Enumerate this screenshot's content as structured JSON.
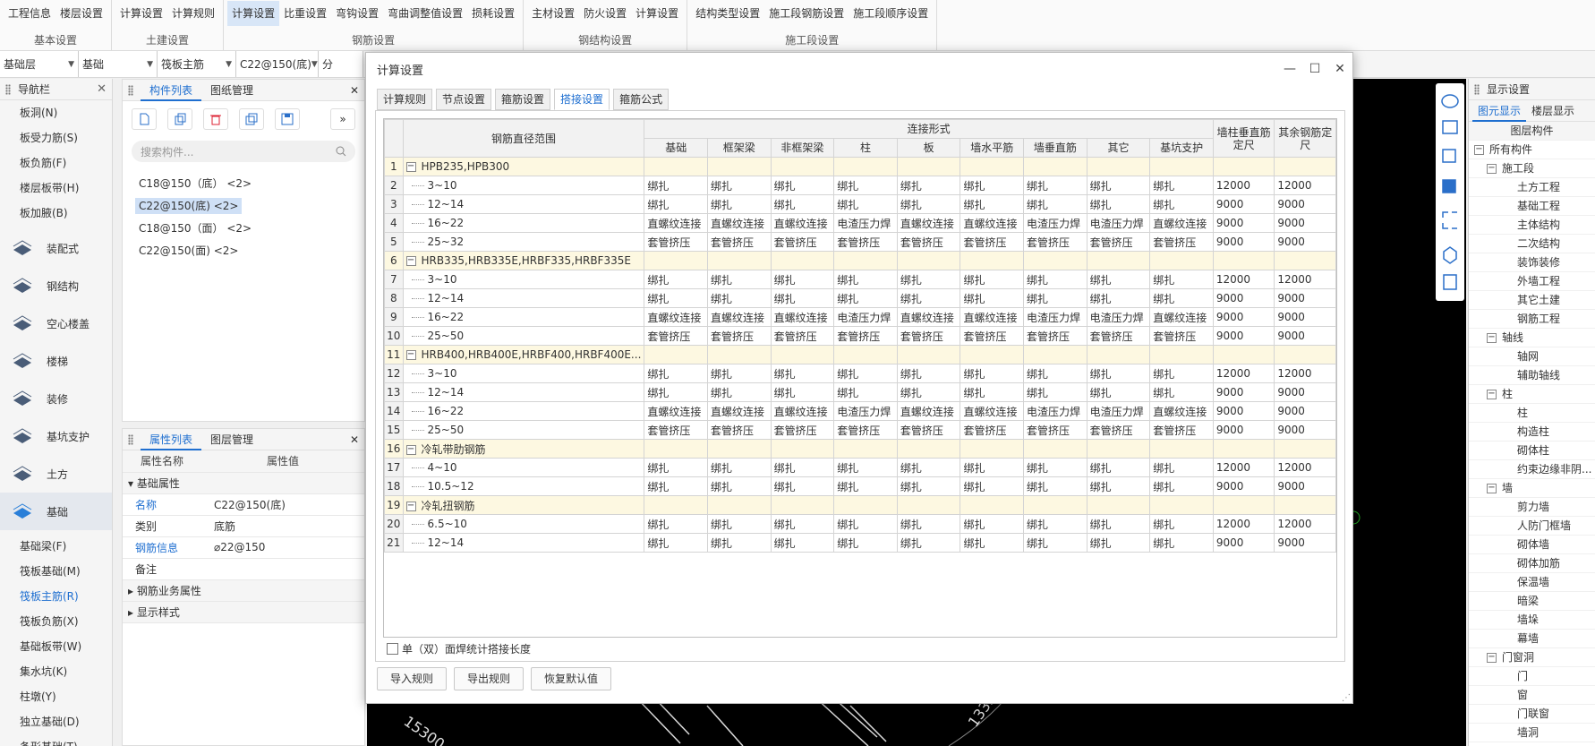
{
  "ribbon": {
    "groups": [
      {
        "title": "基本设置",
        "buttons": [
          "工程信息",
          "楼层设置"
        ]
      },
      {
        "title": "土建设置",
        "buttons": [
          "计算设置",
          "计算规则"
        ]
      },
      {
        "title": "钢筋设置",
        "buttons": [
          "计算设置",
          "比重设置",
          "弯钩设置",
          "弯曲调整值设置",
          "损耗设置"
        ]
      },
      {
        "title": "钢结构设置",
        "buttons": [
          "主材设置",
          "防火设置",
          "计算设置"
        ]
      },
      {
        "title": "施工段设置",
        "buttons": [
          "结构类型设置",
          "施工段钢筋设置",
          "施工段顺序设置"
        ]
      }
    ]
  },
  "selectors": [
    "基础层",
    "基础",
    "筏板主筋",
    "C22@150(底)",
    "分"
  ],
  "nav": {
    "title": "导航栏",
    "items_top": [
      "板洞(N)",
      "板受力筋(S)",
      "板负筋(F)",
      "楼层板带(H)",
      "板加腋(B)"
    ],
    "categories": [
      "装配式",
      "钢结构",
      "空心楼盖",
      "楼梯",
      "装修",
      "基坑支护",
      "土方",
      "基础"
    ],
    "items_bottom": [
      "基础梁(F)",
      "筏板基础(M)",
      "筏板主筋(R)",
      "筏板负筋(X)",
      "基础板带(W)",
      "集水坑(K)",
      "柱墩(Y)",
      "独立基础(D)",
      "条形基础(T)"
    ]
  },
  "complist": {
    "tabs": [
      "构件列表",
      "图纸管理"
    ],
    "search_placeholder": "搜索构件...",
    "items": [
      "C18@150（底） <2>",
      "C22@150(底) <2>",
      "C18@150（面） <2>",
      "C22@150(面) <2>"
    ]
  },
  "props": {
    "tabs": [
      "属性列表",
      "图层管理"
    ],
    "col_name": "属性名称",
    "col_value": "属性值",
    "group1": "基础属性",
    "rows": [
      {
        "name": "名称",
        "value": "C22@150(底)"
      },
      {
        "name": "类别",
        "value": "底筋"
      },
      {
        "name": "钢筋信息",
        "value": "⌀22@150"
      },
      {
        "name": "备注",
        "value": ""
      }
    ],
    "group2": "钢筋业务属性",
    "group3": "显示样式"
  },
  "canvas_labels": [
    "15300",
    "1335"
  ],
  "display": {
    "title": "显示设置",
    "tabs": [
      "图元显示",
      "楼层显示"
    ],
    "header": "图层构件",
    "tree": [
      {
        "level": 0,
        "toggle": true,
        "label": "所有构件"
      },
      {
        "level": 1,
        "toggle": true,
        "label": "施工段"
      },
      {
        "level": 2,
        "toggle": false,
        "label": "土方工程"
      },
      {
        "level": 2,
        "toggle": false,
        "label": "基础工程"
      },
      {
        "level": 2,
        "toggle": false,
        "label": "主体结构"
      },
      {
        "level": 2,
        "toggle": false,
        "label": "二次结构"
      },
      {
        "level": 2,
        "toggle": false,
        "label": "装饰装修"
      },
      {
        "level": 2,
        "toggle": false,
        "label": "外墙工程"
      },
      {
        "level": 2,
        "toggle": false,
        "label": "其它土建"
      },
      {
        "level": 2,
        "toggle": false,
        "label": "钢筋工程"
      },
      {
        "level": 1,
        "toggle": true,
        "label": "轴线"
      },
      {
        "level": 2,
        "toggle": false,
        "label": "轴网"
      },
      {
        "level": 2,
        "toggle": false,
        "label": "辅助轴线"
      },
      {
        "level": 1,
        "toggle": true,
        "label": "柱"
      },
      {
        "level": 2,
        "toggle": false,
        "label": "柱"
      },
      {
        "level": 2,
        "toggle": false,
        "label": "构造柱"
      },
      {
        "level": 2,
        "toggle": false,
        "label": "砌体柱"
      },
      {
        "level": 2,
        "toggle": false,
        "label": "约束边缘非阴..."
      },
      {
        "level": 1,
        "toggle": true,
        "label": "墙"
      },
      {
        "level": 2,
        "toggle": false,
        "label": "剪力墙"
      },
      {
        "level": 2,
        "toggle": false,
        "label": "人防门框墙"
      },
      {
        "level": 2,
        "toggle": false,
        "label": "砌体墙"
      },
      {
        "level": 2,
        "toggle": false,
        "label": "砌体加筋"
      },
      {
        "level": 2,
        "toggle": false,
        "label": "保温墙"
      },
      {
        "level": 2,
        "toggle": false,
        "label": "暗梁"
      },
      {
        "level": 2,
        "toggle": false,
        "label": "墙垛"
      },
      {
        "level": 2,
        "toggle": false,
        "label": "幕墙"
      },
      {
        "level": 1,
        "toggle": true,
        "label": "门窗洞"
      },
      {
        "level": 2,
        "toggle": false,
        "label": "门"
      },
      {
        "level": 2,
        "toggle": false,
        "label": "窗"
      },
      {
        "level": 2,
        "toggle": false,
        "label": "门联窗"
      },
      {
        "level": 2,
        "toggle": false,
        "label": "墙洞"
      }
    ]
  },
  "dialog": {
    "title": "计算设置",
    "tabs": [
      "计算规则",
      "节点设置",
      "箍筋设置",
      "搭接设置",
      "箍筋公式"
    ],
    "active_tab": 3,
    "header": {
      "diameter": "钢筋直径范围",
      "connection": "连接形式",
      "cols": [
        "基础",
        "框架梁",
        "非框架梁",
        "柱",
        "板",
        "墙水平筋",
        "墙垂直筋",
        "其它",
        "基坑支护"
      ],
      "col_wall": "墙柱垂直筋定尺",
      "col_other": "其余钢筋定尺"
    },
    "rows": [
      {
        "n": "1",
        "group": true,
        "label": "HPB235,HPB300"
      },
      {
        "n": "2",
        "label": "3~10",
        "c": [
          "绑扎",
          "绑扎",
          "绑扎",
          "绑扎",
          "绑扎",
          "绑扎",
          "绑扎",
          "绑扎",
          "绑扎"
        ],
        "w": "12000",
        "o": "12000"
      },
      {
        "n": "3",
        "label": "12~14",
        "c": [
          "绑扎",
          "绑扎",
          "绑扎",
          "绑扎",
          "绑扎",
          "绑扎",
          "绑扎",
          "绑扎",
          "绑扎"
        ],
        "w": "9000",
        "o": "9000"
      },
      {
        "n": "4",
        "label": "16~22",
        "c": [
          "直螺纹连接",
          "直螺纹连接",
          "直螺纹连接",
          "电渣压力焊",
          "直螺纹连接",
          "直螺纹连接",
          "电渣压力焊",
          "电渣压力焊",
          "直螺纹连接"
        ],
        "w": "9000",
        "o": "9000"
      },
      {
        "n": "5",
        "label": "25~32",
        "c": [
          "套管挤压",
          "套管挤压",
          "套管挤压",
          "套管挤压",
          "套管挤压",
          "套管挤压",
          "套管挤压",
          "套管挤压",
          "套管挤压"
        ],
        "w": "9000",
        "o": "9000"
      },
      {
        "n": "6",
        "group": true,
        "label": "HRB335,HRB335E,HRBF335,HRBF335E"
      },
      {
        "n": "7",
        "label": "3~10",
        "c": [
          "绑扎",
          "绑扎",
          "绑扎",
          "绑扎",
          "绑扎",
          "绑扎",
          "绑扎",
          "绑扎",
          "绑扎"
        ],
        "w": "12000",
        "o": "12000"
      },
      {
        "n": "8",
        "label": "12~14",
        "c": [
          "绑扎",
          "绑扎",
          "绑扎",
          "绑扎",
          "绑扎",
          "绑扎",
          "绑扎",
          "绑扎",
          "绑扎"
        ],
        "w": "9000",
        "o": "9000"
      },
      {
        "n": "9",
        "label": "16~22",
        "c": [
          "直螺纹连接",
          "直螺纹连接",
          "直螺纹连接",
          "电渣压力焊",
          "直螺纹连接",
          "直螺纹连接",
          "电渣压力焊",
          "电渣压力焊",
          "直螺纹连接"
        ],
        "w": "9000",
        "o": "9000"
      },
      {
        "n": "10",
        "label": "25~50",
        "c": [
          "套管挤压",
          "套管挤压",
          "套管挤压",
          "套管挤压",
          "套管挤压",
          "套管挤压",
          "套管挤压",
          "套管挤压",
          "套管挤压"
        ],
        "w": "9000",
        "o": "9000"
      },
      {
        "n": "11",
        "group": true,
        "label": "HRB400,HRB400E,HRBF400,HRBF400E..."
      },
      {
        "n": "12",
        "label": "3~10",
        "c": [
          "绑扎",
          "绑扎",
          "绑扎",
          "绑扎",
          "绑扎",
          "绑扎",
          "绑扎",
          "绑扎",
          "绑扎"
        ],
        "w": "12000",
        "o": "12000"
      },
      {
        "n": "13",
        "label": "12~14",
        "c": [
          "绑扎",
          "绑扎",
          "绑扎",
          "绑扎",
          "绑扎",
          "绑扎",
          "绑扎",
          "绑扎",
          "绑扎"
        ],
        "w": "9000",
        "o": "9000"
      },
      {
        "n": "14",
        "label": "16~22",
        "c": [
          "直螺纹连接",
          "直螺纹连接",
          "直螺纹连接",
          "电渣压力焊",
          "直螺纹连接",
          "直螺纹连接",
          "电渣压力焊",
          "电渣压力焊",
          "直螺纹连接"
        ],
        "w": "9000",
        "o": "9000"
      },
      {
        "n": "15",
        "label": "25~50",
        "c": [
          "套管挤压",
          "套管挤压",
          "套管挤压",
          "套管挤压",
          "套管挤压",
          "套管挤压",
          "套管挤压",
          "套管挤压",
          "套管挤压"
        ],
        "w": "9000",
        "o": "9000"
      },
      {
        "n": "16",
        "group": true,
        "label": "冷轧带肋钢筋"
      },
      {
        "n": "17",
        "label": "4~10",
        "c": [
          "绑扎",
          "绑扎",
          "绑扎",
          "绑扎",
          "绑扎",
          "绑扎",
          "绑扎",
          "绑扎",
          "绑扎"
        ],
        "w": "12000",
        "o": "12000"
      },
      {
        "n": "18",
        "label": "10.5~12",
        "c": [
          "绑扎",
          "绑扎",
          "绑扎",
          "绑扎",
          "绑扎",
          "绑扎",
          "绑扎",
          "绑扎",
          "绑扎"
        ],
        "w": "9000",
        "o": "9000"
      },
      {
        "n": "19",
        "group": true,
        "label": "冷轧扭钢筋"
      },
      {
        "n": "20",
        "label": "6.5~10",
        "c": [
          "绑扎",
          "绑扎",
          "绑扎",
          "绑扎",
          "绑扎",
          "绑扎",
          "绑扎",
          "绑扎",
          "绑扎"
        ],
        "w": "12000",
        "o": "12000"
      },
      {
        "n": "21",
        "label": "12~14",
        "c": [
          "绑扎",
          "绑扎",
          "绑扎",
          "绑扎",
          "绑扎",
          "绑扎",
          "绑扎",
          "绑扎",
          "绑扎"
        ],
        "w": "9000",
        "o": "9000"
      }
    ],
    "checkbox_label": "单（双）面焊统计搭接长度",
    "buttons": [
      "导入规则",
      "导出规则",
      "恢复默认值"
    ]
  }
}
